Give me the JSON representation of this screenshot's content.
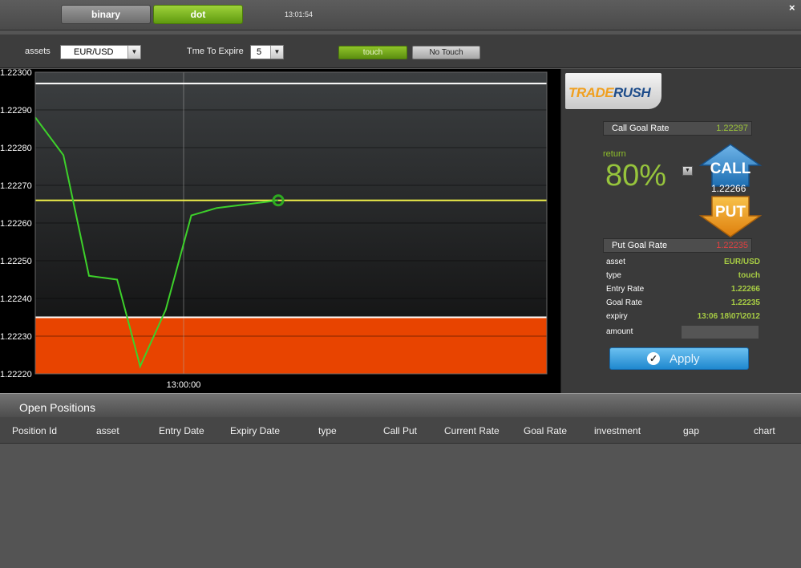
{
  "top": {
    "tabs": [
      "binary",
      "dot"
    ],
    "clock": "13:01:54",
    "close_icon": "×"
  },
  "options": {
    "assets_label": "assets",
    "asset_value": "EUR/USD",
    "expire_label": "Tme To Expire",
    "expire_value": "5",
    "touch_label": "touch",
    "notouch_label": "No Touch"
  },
  "chart_data": {
    "type": "line",
    "y_ticks": [
      "1.22300",
      "1.22290",
      "1.22280",
      "1.22270",
      "1.22260",
      "1.22250",
      "1.22240",
      "1.22230",
      "1.22220"
    ],
    "ylim": [
      1.2222,
      1.223
    ],
    "x_tick_label": "13:00:00",
    "series": [
      {
        "color": "#3dd12a",
        "points": [
          [
            0.0,
            1.22288
          ],
          [
            0.055,
            1.22278
          ],
          [
            0.105,
            1.22246
          ],
          [
            0.16,
            1.22245
          ],
          [
            0.205,
            1.22222
          ],
          [
            0.255,
            1.22237
          ],
          [
            0.305,
            1.22262
          ],
          [
            0.355,
            1.22264
          ],
          [
            0.475,
            1.22266
          ]
        ]
      }
    ],
    "current_rate": 1.22266,
    "call_goal": 1.22297,
    "put_goal": 1.22235,
    "colors": {
      "current_line": "#f0f04a",
      "put_zone": "#e84400",
      "goal_line": "#ffffff"
    }
  },
  "panel": {
    "logo_left": "TRADE",
    "logo_right": "RUSH",
    "call_goal_label": "Call Goal Rate",
    "call_goal_value": "1.22297",
    "return_label": "return",
    "return_value": "80%",
    "call_label": "CALL",
    "current_rate": "1.22266",
    "put_label": "PUT",
    "put_goal_label": "Put Goal Rate",
    "put_goal_value": "1.22235",
    "info": [
      {
        "key": "asset",
        "value": "EUR/USD"
      },
      {
        "key": "type",
        "value": "touch"
      },
      {
        "key": "Entry Rate",
        "value": "1.22266"
      },
      {
        "key": "Goal Rate",
        "value": "1.22235"
      },
      {
        "key": "expiry",
        "value": "13:06 18\\07\\2012"
      }
    ],
    "amount_label": "amount",
    "apply_label": "Apply"
  },
  "positions": {
    "title": "Open Positions",
    "columns": [
      "Position Id",
      "asset",
      "Entry Date",
      "Expiry Date",
      "type",
      "Call Put",
      "Current Rate",
      "Goal Rate",
      "investment",
      "gap",
      "chart"
    ]
  }
}
